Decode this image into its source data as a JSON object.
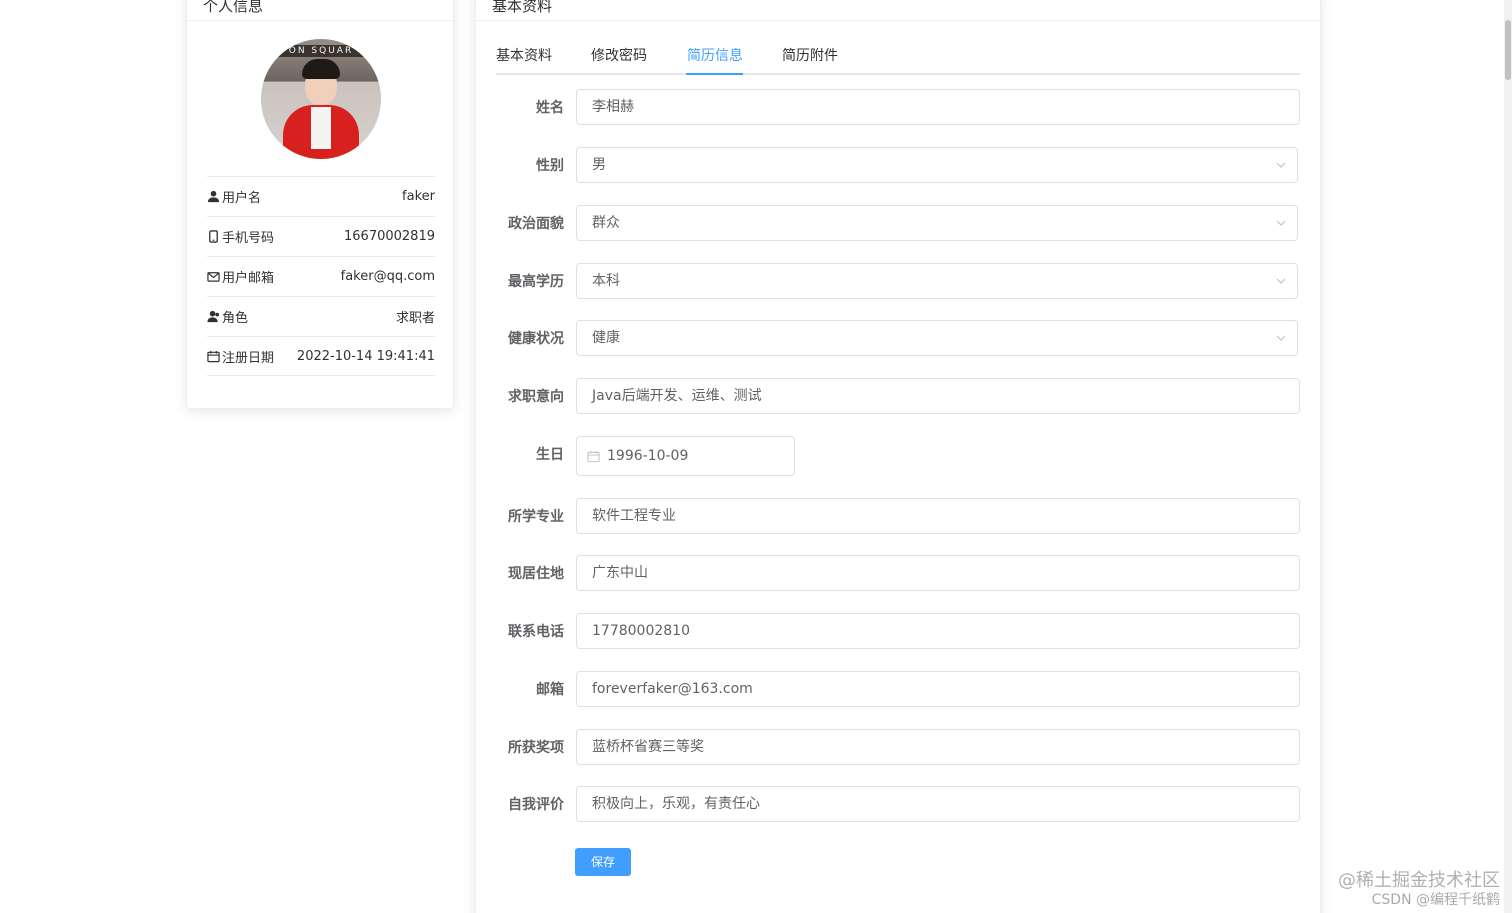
{
  "profile": {
    "title": "个人信息",
    "avatar_sign": "ON SQUAR",
    "rows": [
      {
        "icon": "user-icon",
        "label": "用户名",
        "value": "faker"
      },
      {
        "icon": "phone-icon",
        "label": "手机号码",
        "value": "16670002819"
      },
      {
        "icon": "mail-icon",
        "label": "用户邮箱",
        "value": "faker@qq.com"
      },
      {
        "icon": "role-icon",
        "label": "角色",
        "value": "求职者"
      },
      {
        "icon": "calendar-icon",
        "label": "注册日期",
        "value": "2022-10-14 19:41:41"
      }
    ]
  },
  "main": {
    "title": "基本资料",
    "tabs": [
      "基本资料",
      "修改密码",
      "简历信息",
      "简历附件"
    ],
    "active_tab": "简历信息",
    "form": {
      "name": {
        "label": "姓名",
        "value": "李相赫"
      },
      "gender": {
        "label": "性别",
        "value": "男"
      },
      "political": {
        "label": "政治面貌",
        "value": "群众"
      },
      "education": {
        "label": "最高学历",
        "value": "本科"
      },
      "health": {
        "label": "健康状况",
        "value": "健康"
      },
      "intention": {
        "label": "求职意向",
        "value": "Java后端开发、运维、测试"
      },
      "birthday": {
        "label": "生日",
        "value": "1996-10-09"
      },
      "major": {
        "label": "所学专业",
        "value": "软件工程专业"
      },
      "address": {
        "label": "现居住地",
        "value": "广东中山"
      },
      "phone": {
        "label": "联系电话",
        "value": "17780002810"
      },
      "email": {
        "label": "邮箱",
        "value": "foreverfaker@163.com"
      },
      "awards": {
        "label": "所获奖项",
        "value": "蓝桥杯省赛三等奖"
      },
      "self_eval": {
        "label": "自我评价",
        "value": "积极向上，乐观，有责任心"
      }
    },
    "save_label": "保存"
  },
  "watermark": {
    "line1": "@稀土掘金技术社区",
    "line2": "CSDN @编程千纸鹤"
  },
  "colors": {
    "accent": "#409eff",
    "border": "#dcdfe6"
  }
}
